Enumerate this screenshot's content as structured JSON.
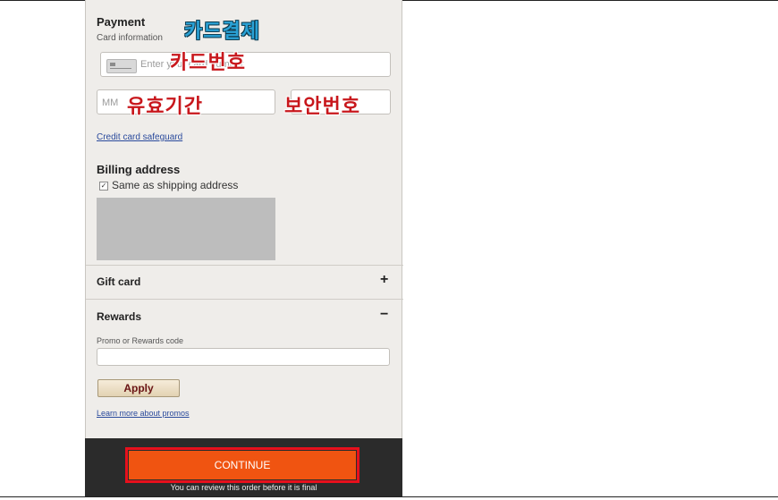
{
  "payment": {
    "title": "Payment",
    "subtitle": "Card information",
    "annotation_card_payment": "카드결제",
    "card_number_placeholder": "Enter your card number",
    "annotation_card_number": "카드번호",
    "expiry_month_placeholder": "MM",
    "annotation_expiry": "유효기간",
    "annotation_security_code": "보안번호",
    "safeguard_link": "Credit card safeguard"
  },
  "billing": {
    "title": "Billing address",
    "same_as_shipping_label": "Same as shipping address",
    "same_as_shipping_checked": true
  },
  "gift_card": {
    "title": "Gift card",
    "toggle": "+"
  },
  "rewards": {
    "title": "Rewards",
    "toggle": "−",
    "code_label": "Promo or Rewards code",
    "apply_label": "Apply",
    "learn_link": "Learn more about promos"
  },
  "footer": {
    "continue_label": "CONTINUE",
    "note": "You can review this order before it is final"
  },
  "colors": {
    "continue_bg": "#f05411",
    "highlight_border": "#e8101c",
    "annotation_blue": "#2aa2d6",
    "annotation_red": "#c8171c"
  },
  "icons": {
    "card": "credit-card-icon"
  }
}
